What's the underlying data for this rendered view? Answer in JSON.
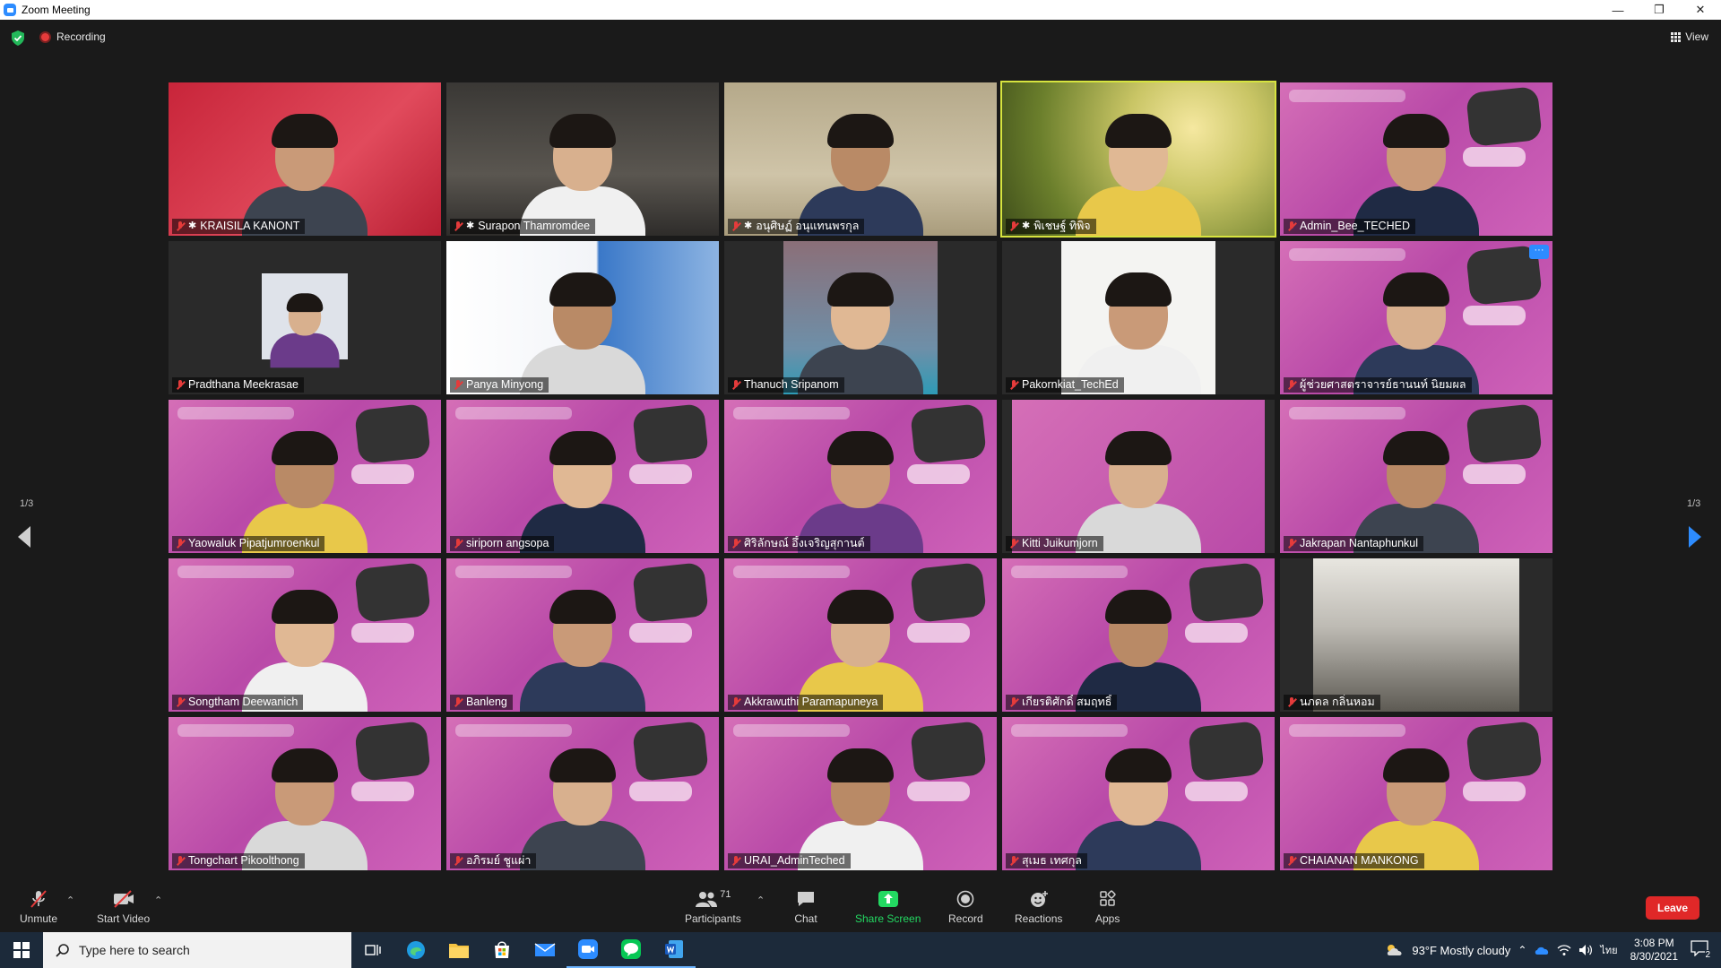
{
  "window": {
    "title": "Zoom Meeting",
    "minimize": "—",
    "maximize": "❐",
    "close": "✕"
  },
  "topbar": {
    "recording_label": "Recording",
    "view_label": "View"
  },
  "gallery": {
    "page_indicator_left": "1/3",
    "page_indicator_right": "1/3",
    "tiles": [
      {
        "name": "KRAISILA KANONT",
        "pinned": true
      },
      {
        "name": "Surapon Thamromdee",
        "pinned": true
      },
      {
        "name": "อนุศิษฏ์ อนุแทนพรกุล",
        "pinned": true
      },
      {
        "name": "พิเชษฐ์ ทิพิจ",
        "pinned": true,
        "active": true
      },
      {
        "name": "Admin_Bee_TECHED",
        "pinned": false
      },
      {
        "name": "Pradthana Meekrasae",
        "pinned": false
      },
      {
        "name": "Panya Minyong",
        "pinned": false
      },
      {
        "name": "Thanuch Sripanom",
        "pinned": false
      },
      {
        "name": "Pakornkiat_TechEd",
        "pinned": false
      },
      {
        "name": "ผู้ช่วยศาสตราจารย์ธานนท์ นิยมผล",
        "pinned": false
      },
      {
        "name": "Yaowaluk Pipatjumroenkul",
        "pinned": false
      },
      {
        "name": "siriporn angsopa",
        "pinned": false
      },
      {
        "name": "ศิริลักษณ์ อึ้งเจริญสุกานต์",
        "pinned": false
      },
      {
        "name": "Kitti Juikumjorn",
        "pinned": false
      },
      {
        "name": "Jakrapan Nantaphunkul",
        "pinned": false
      },
      {
        "name": "Songtham Deewanich",
        "pinned": false
      },
      {
        "name": "Banleng",
        "pinned": false
      },
      {
        "name": "Akkrawuthi Paramapuneya",
        "pinned": false
      },
      {
        "name": "เกียรติศักดิ์ สมฤทธิ์",
        "pinned": false
      },
      {
        "name": "นภดล กลิ่นหอม",
        "pinned": false
      },
      {
        "name": "Tongchart Pikoolthong",
        "pinned": false
      },
      {
        "name": "อภิรมย์ ชูแผ่า",
        "pinned": false
      },
      {
        "name": "URAI_AdminTeched",
        "pinned": false
      },
      {
        "name": "สุเมธ เทศกุล",
        "pinned": false
      },
      {
        "name": "CHAIANAN MANKONG",
        "pinned": false
      }
    ]
  },
  "toolbar": {
    "unmute": "Unmute",
    "start_video": "Start Video",
    "participants": "Participants",
    "participants_count": "71",
    "chat": "Chat",
    "share_screen": "Share Screen",
    "record": "Record",
    "reactions": "Reactions",
    "apps": "Apps",
    "leave": "Leave"
  },
  "taskbar": {
    "search_placeholder": "Type here to search",
    "weather": "93°F  Mostly cloudy",
    "language": "ไทย",
    "time": "3:08 PM",
    "date": "8/30/2021",
    "notifications": "2"
  },
  "colors": {
    "accent_green": "#23d962",
    "leave_red": "#e02828",
    "active_speaker": "#d7e43f",
    "mute_red": "#e53b3b"
  }
}
